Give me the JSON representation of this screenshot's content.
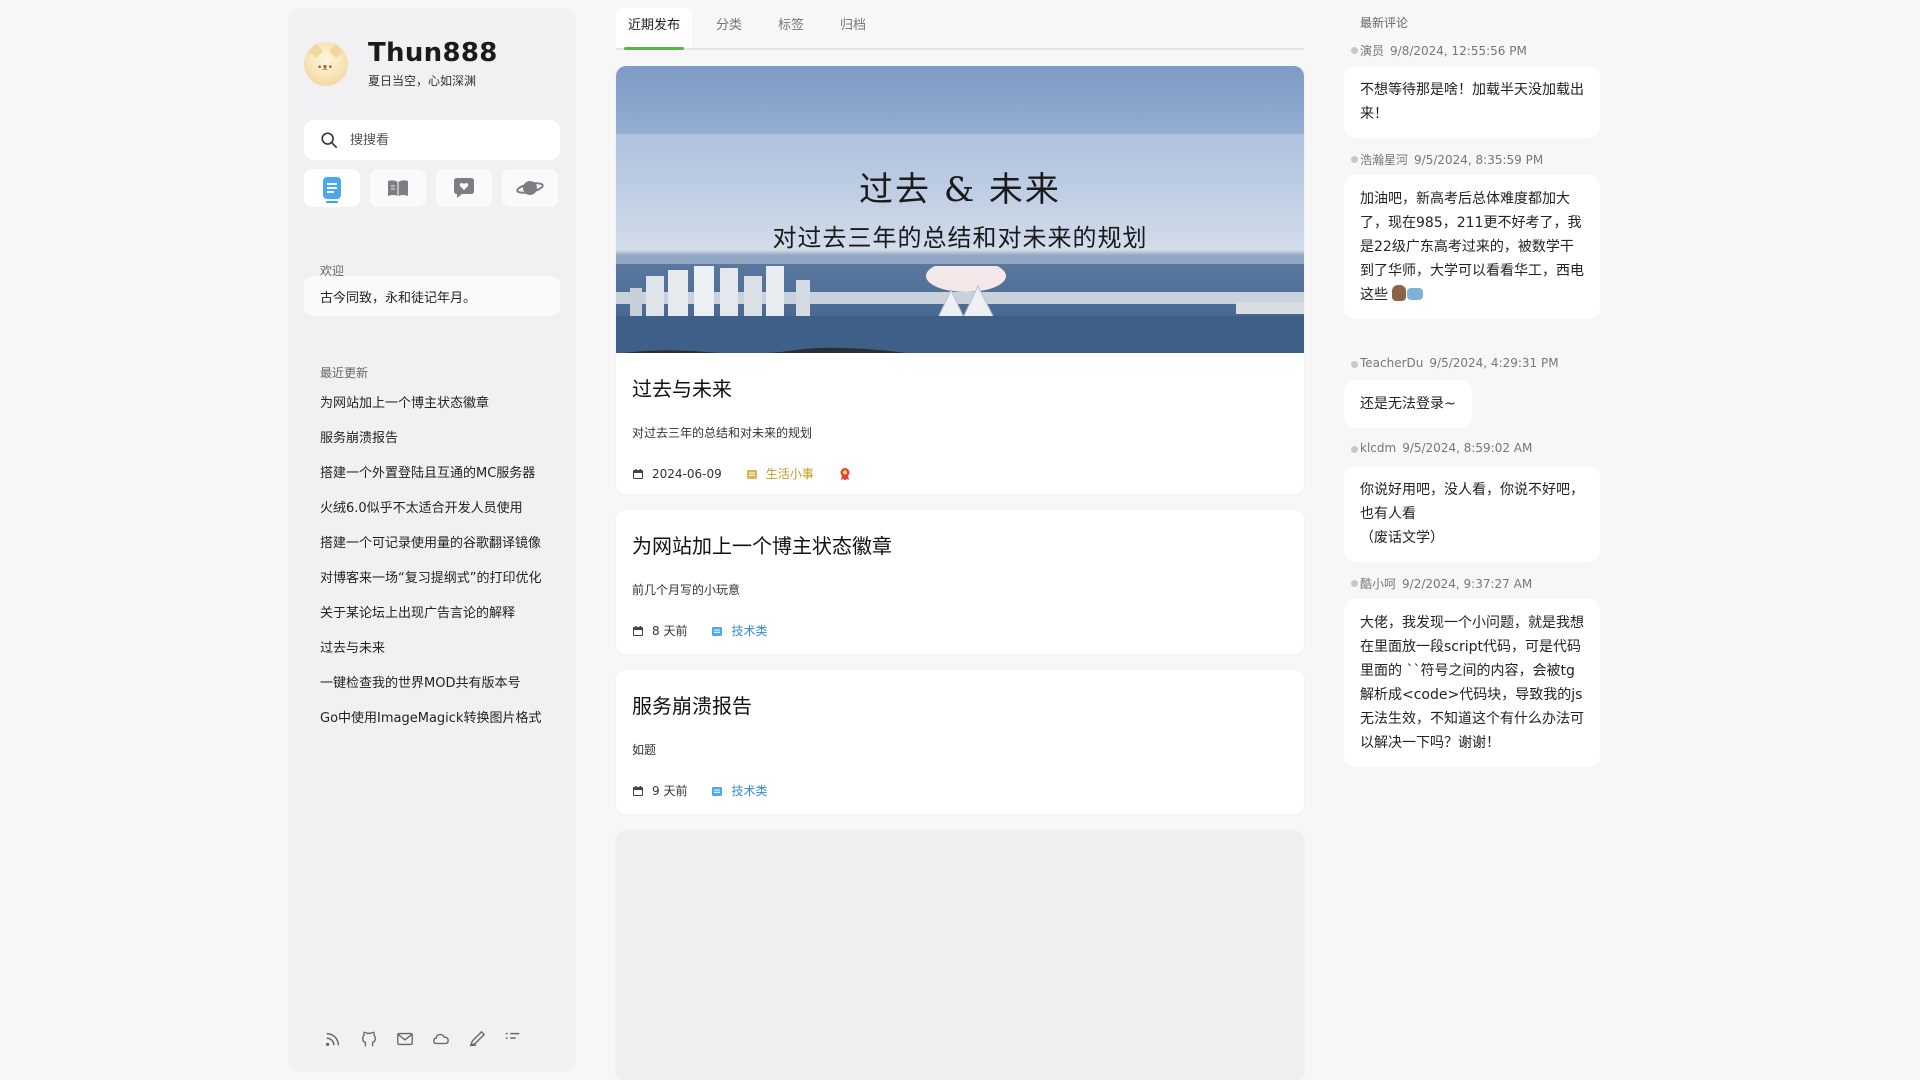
{
  "sidebar": {
    "site_name": "Thun888",
    "motto": "夏日当空，心如深渊",
    "search_placeholder": "搜搜看",
    "icon_tabs": [
      {
        "icon": "document-icon",
        "active": true
      },
      {
        "icon": "book-icon",
        "active": false
      },
      {
        "icon": "chat-heart-icon",
        "active": false
      },
      {
        "icon": "planet-icon",
        "active": false
      }
    ],
    "welcome_label": "欢迎",
    "welcome_text": "古今同致，永和徒记年月。",
    "recent_label": "最近更新",
    "recent_items": [
      "为网站加上一个博主状态徽章",
      "服务崩溃报告",
      "搭建一个外置登陆且互通的MC服务器",
      "火绒6.0似乎不太适合开发人员使用",
      "搭建一个可记录使用量的谷歌翻译镜像",
      "对博客来一场“复习提纲式”的打印优化",
      "关于某论坛上出现广告言论的解释",
      "过去与未来",
      "一键检查我的世界MOD共有版本号",
      "Go中使用ImageMagick转换图片格式"
    ],
    "footer_icons": [
      "rss-icon",
      "github-icon",
      "mail-icon",
      "cloud-icon",
      "pen-icon",
      "list-icon"
    ]
  },
  "main": {
    "tabs": [
      {
        "label": "近期发布",
        "active": true
      },
      {
        "label": "分类",
        "active": false
      },
      {
        "label": "标签",
        "active": false
      },
      {
        "label": "归档",
        "active": false
      }
    ],
    "posts": [
      {
        "banner_title": "过去 & 未来",
        "banner_subtitle": "对过去三年的总结和对未来的规划",
        "title": "过去与未来",
        "summary": "对过去三年的总结和对未来的规划",
        "date": "2024-06-09",
        "category": "生活小事",
        "category_color": "#c99a1e",
        "badge_icon": "award-icon"
      },
      {
        "title": "为网站加上一个博主状态徽章",
        "summary": "前几个月写的小玩意",
        "date": "8 天前",
        "category": "技术类",
        "category_color": "#2f8fd6"
      },
      {
        "title": "服务崩溃报告",
        "summary": "如题",
        "date": "9 天前",
        "category": "技术类",
        "category_color": "#2f8fd6"
      }
    ]
  },
  "comments": {
    "label": "最新评论",
    "items": [
      {
        "author": "演员",
        "time": "9/8/2024, 12:55:56 PM",
        "text": "不想等待那是啥！加载半天没加载出来！"
      },
      {
        "author": "浩瀚星河",
        "time": "9/5/2024, 8:35:59 PM",
        "text": "加油吧，新高考后总体难度都加大了，现在985，211更不好考了，我是22级广东高考过来的，被数学干到了华师，大学可以看看华工，西电这些"
      },
      {
        "author": "TeacherDu",
        "time": "9/5/2024, 4:29:31 PM",
        "text": "还是无法登录~"
      },
      {
        "author": "klcdm",
        "time": "9/5/2024, 8:59:02 AM",
        "text": "你说好用吧，没人看，你说不好吧，也有人看\n（废话文学）"
      },
      {
        "author": "酷小呵",
        "time": "9/2/2024, 9:37:27 AM",
        "text": "大佬，我发现一个小问题，就是我想在里面放一段script代码，可是代码里面的 ``符号之间的内容，会被tg解析成<code>代码块，导致我的js无法生效，不知道这个有什么办法可以解决一下吗？谢谢！"
      }
    ]
  }
}
